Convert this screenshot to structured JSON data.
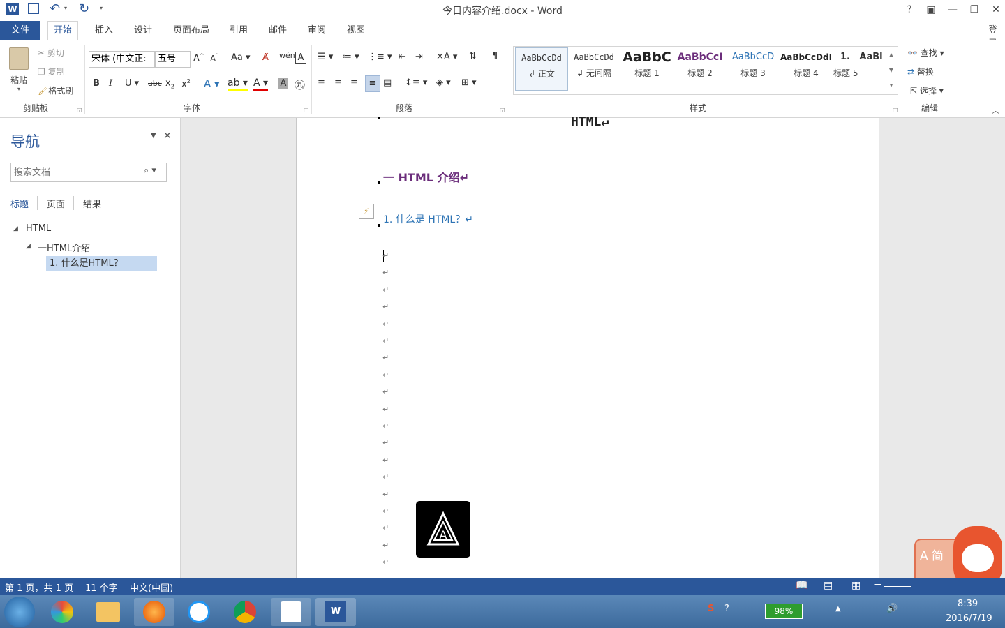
{
  "titlebar": {
    "title": "今日内容介绍.docx - Word",
    "help": "?",
    "restore_ribbon": "▣",
    "minimize": "—",
    "restore": "❐",
    "close": "✕",
    "signin": "登录"
  },
  "quick_access": {
    "word_icon": "word-icon",
    "save_icon": "save-icon",
    "undo_icon": "undo-icon",
    "redo_icon": "redo-icon"
  },
  "tabs": [
    "文件",
    "开始",
    "插入",
    "设计",
    "页面布局",
    "引用",
    "邮件",
    "审阅",
    "视图"
  ],
  "active_tab": "开始",
  "clipboard": {
    "paste": "粘贴",
    "cut": "剪切",
    "copy": "复制",
    "format_painter": "格式刷",
    "label": "剪贴板"
  },
  "font": {
    "family": "宋体 (中文正:",
    "size": "五号",
    "label": "字体"
  },
  "paragraph": {
    "label": "段落"
  },
  "styles": {
    "label": "样式",
    "items": [
      {
        "preview": "AaBbCcDd",
        "name": "↲ 正文"
      },
      {
        "preview": "AaBbCcDd",
        "name": "↲ 无间隔"
      },
      {
        "preview": "AaBbC",
        "name": "标题 1"
      },
      {
        "preview": "AaBbCcI",
        "name": "标题 2"
      },
      {
        "preview": "AaBbCcD",
        "name": "标题 3"
      },
      {
        "preview": "AaBbCcDdI",
        "name": "标题 4"
      },
      {
        "preview": "1.",
        "name": "标题 5"
      },
      {
        "preview": "AaBl",
        "name": ""
      }
    ]
  },
  "editing": {
    "find": "查找",
    "replace": "替换",
    "select": "选择",
    "label": "编辑"
  },
  "nav": {
    "title": "导航",
    "search_placeholder": "搜索文档",
    "tabs": [
      "标题",
      "页面",
      "结果"
    ],
    "tree": [
      {
        "label": "HTML",
        "level": 0
      },
      {
        "label": "一HTML介绍",
        "level": 1
      },
      {
        "label": "1. 什么是HTML？",
        "level": 2
      }
    ]
  },
  "document": {
    "heading_html": "HTML↵",
    "heading_intro": "一 HTML 介绍↵",
    "heading_what": "1.  什么是 HTML？↵",
    "para_marks": 19
  },
  "status": {
    "pages": "第 1 页，共 1 页",
    "words": "11 个字",
    "language": "中文(中国)"
  },
  "taskbar": {
    "battery": "98%",
    "time": "8:39",
    "date": "2016/7/19"
  },
  "colors": {
    "accent": "#2b579a",
    "heading_purple": "#6b2d7b",
    "heading_blue": "#2e74b5"
  }
}
